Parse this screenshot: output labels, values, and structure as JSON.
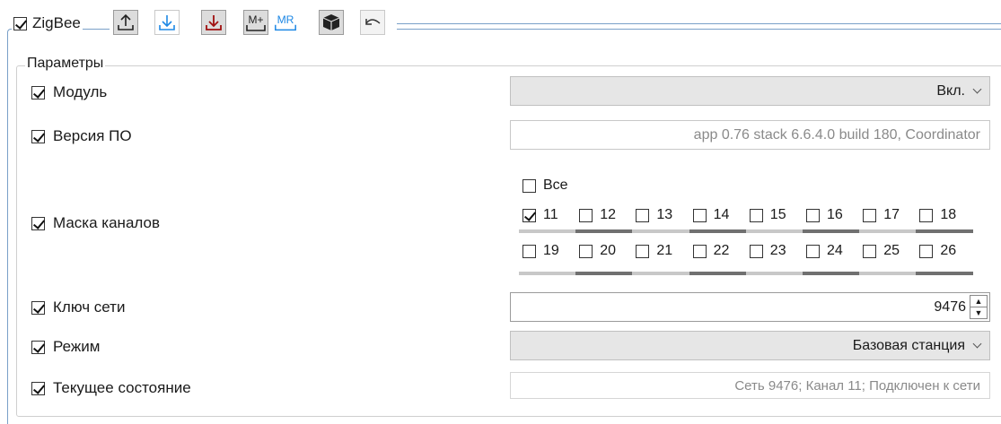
{
  "group": {
    "title": "ZigBee",
    "checked": true
  },
  "toolbar": {
    "upload_icon": "upload-icon",
    "download_blue_icon": "download-icon",
    "download_red_icon": "download-icon",
    "mem_plus_label": "M+",
    "mem_recall_label": "MR",
    "box_icon": "box-icon",
    "undo_icon": "undo-icon"
  },
  "params": {
    "title": "Параметры",
    "module": {
      "label": "Модуль",
      "value": "Вкл."
    },
    "firmware": {
      "label": "Версия ПО",
      "value": "app 0.76 stack 6.6.4.0 build 180, Coordinator"
    },
    "channels": {
      "label": "Маска каналов",
      "all_label": "Все",
      "row1": [
        {
          "label": "11",
          "checked": true
        },
        {
          "label": "12",
          "checked": false
        },
        {
          "label": "13",
          "checked": false
        },
        {
          "label": "14",
          "checked": false
        },
        {
          "label": "15",
          "checked": false
        },
        {
          "label": "16",
          "checked": false
        },
        {
          "label": "17",
          "checked": false
        },
        {
          "label": "18",
          "checked": false
        }
      ],
      "row2": [
        {
          "label": "19",
          "checked": false
        },
        {
          "label": "20",
          "checked": false
        },
        {
          "label": "21",
          "checked": false
        },
        {
          "label": "22",
          "checked": false
        },
        {
          "label": "23",
          "checked": false
        },
        {
          "label": "24",
          "checked": false
        },
        {
          "label": "25",
          "checked": false
        },
        {
          "label": "26",
          "checked": false
        }
      ]
    },
    "network_key": {
      "label": "Ключ сети",
      "value": "9476"
    },
    "mode": {
      "label": "Режим",
      "value": "Базовая станция"
    },
    "status": {
      "label": "Текущее состояние",
      "value": "Сеть 9476; Канал 11; Подключен к сети"
    }
  },
  "colors": {
    "frame": "#7aa0c8",
    "bar_light": "#c8c8c8",
    "bar_dark": "#707070",
    "blue": "#1e88e5",
    "red": "#a01010"
  }
}
